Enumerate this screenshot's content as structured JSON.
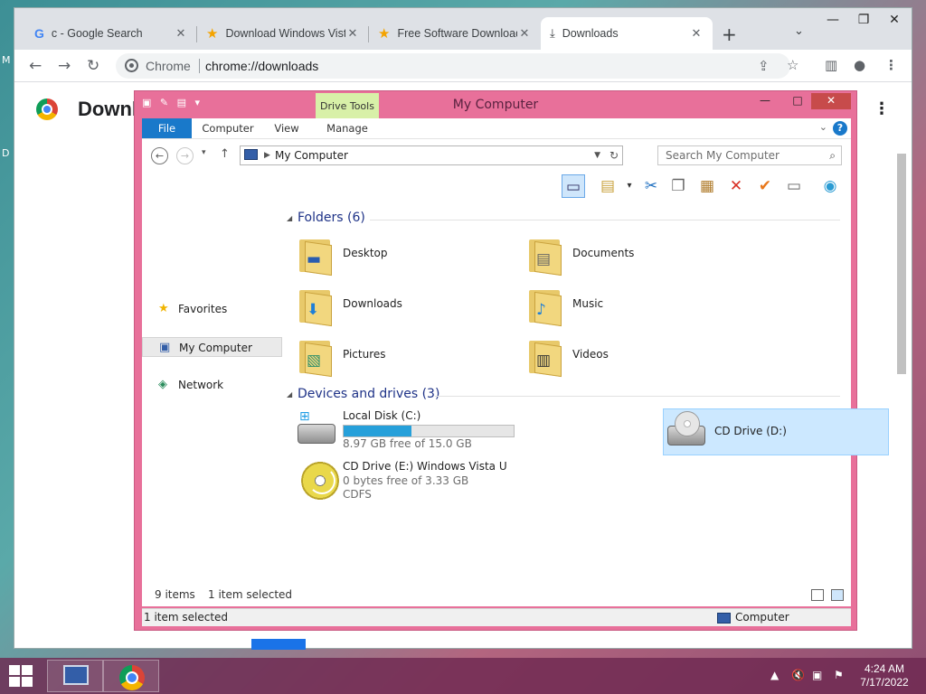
{
  "chrome": {
    "tabs": [
      {
        "label": "c - Google Search",
        "icon": "google-icon",
        "close": "✕"
      },
      {
        "label": "Download Windows Vista",
        "icon": "star-icon",
        "close": "✕"
      },
      {
        "label": "Free Software Download",
        "icon": "star-icon",
        "close": "✕"
      },
      {
        "label": "Downloads",
        "icon": "download-icon",
        "close": "✕"
      }
    ],
    "new_tab": "+",
    "tab_search": "⌄",
    "omnibox": {
      "scheme_label": "Chrome",
      "url": "chrome://downloads"
    },
    "page_title": "Downloads",
    "more_menu": "⋮"
  },
  "explorer": {
    "title": "My Computer",
    "contextual_tab": "Drive Tools",
    "ribbon_tabs": [
      "File",
      "Computer",
      "View",
      "Manage"
    ],
    "address": "My Computer",
    "search_placeholder": "Search My Computer",
    "nav": {
      "favorites": "Favorites",
      "my_computer": "My Computer",
      "network": "Network"
    },
    "folders_header": "Folders (6)",
    "folders": [
      "Desktop",
      "Documents",
      "Downloads",
      "Music",
      "Pictures",
      "Videos"
    ],
    "drives_header": "Devices and drives (3)",
    "drives": {
      "c": {
        "name": "Local Disk (C:)",
        "free": "8.97 GB free of 15.0 GB",
        "used_fraction": 0.4
      },
      "d": {
        "name": "CD Drive (D:)"
      },
      "e": {
        "name": "CD Drive (E:) Windows Vista U",
        "free": "0 bytes free of 3.33 GB",
        "fs": "CDFS"
      }
    },
    "status": {
      "count": "9 items",
      "selected": "1 item selected"
    },
    "statusbar": {
      "selected": "1 item selected",
      "location": "Computer"
    }
  },
  "taskbar": {
    "time": "4:24 AM",
    "date": "7/17/2022"
  },
  "colors": {
    "accent": "#1979ca",
    "window_frame": "#e8709a",
    "selection": "#cce8ff"
  }
}
